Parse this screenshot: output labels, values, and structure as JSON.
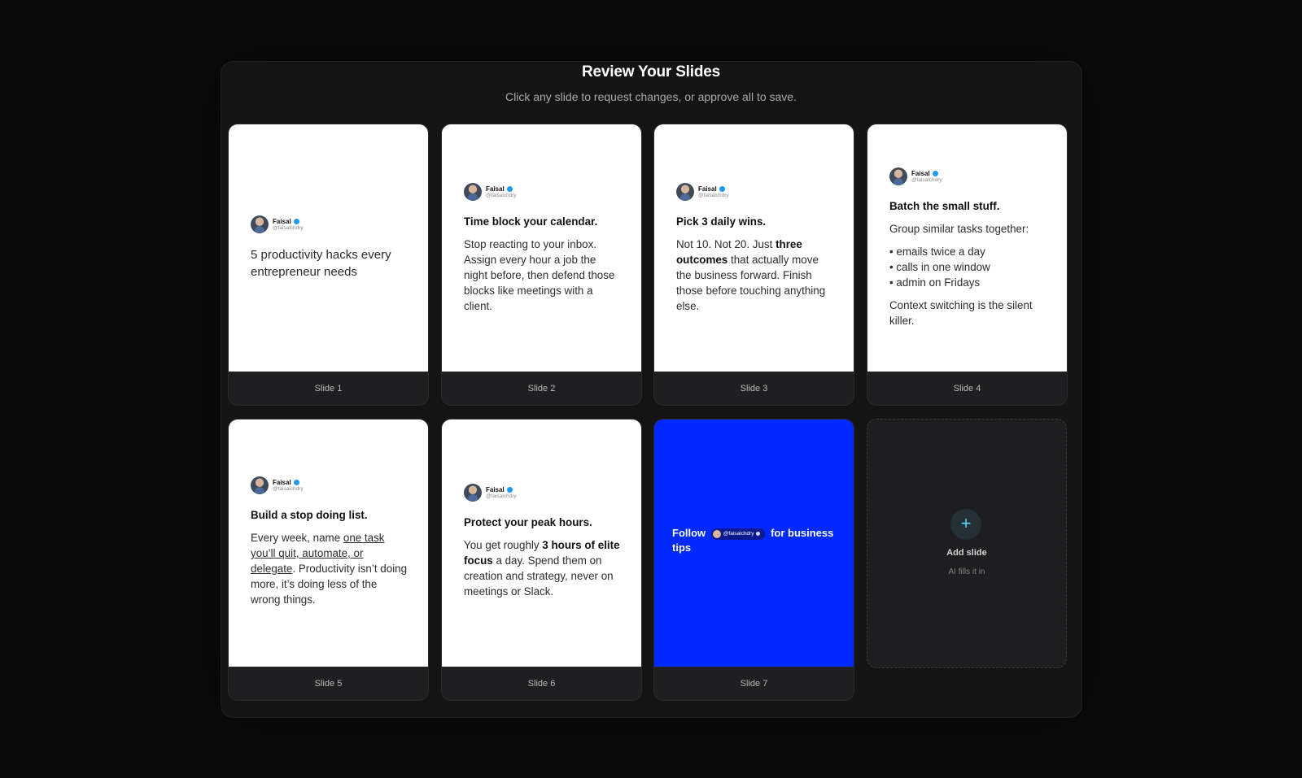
{
  "header": {
    "title": "Review Your Slides",
    "subtitle": "Click any slide to request changes, or approve all to save."
  },
  "author": {
    "name": "Faisal",
    "handle": "@faisalchdry"
  },
  "slides": [
    {
      "label": "Slide 1",
      "text": "5 productivity hacks every entrepreneur needs"
    },
    {
      "label": "Slide 2",
      "heading": "Time block your calendar.",
      "body": "Stop reacting to your inbox. Assign every hour a job the night before, then defend those blocks like meetings with a client."
    },
    {
      "label": "Slide 3",
      "heading": "Pick 3 daily wins.",
      "body_pre": "Not 10. Not 20. Just ",
      "body_bold": "three outcomes",
      "body_post": " that actually move the business forward. Finish those before touching anything else."
    },
    {
      "label": "Slide 4",
      "heading": "Batch the small stuff.",
      "intro": "Group similar tasks together:",
      "items": [
        "• emails twice a day",
        "• calls in one window",
        "• admin on Fridays"
      ],
      "outro": "Context switching is the silent killer."
    },
    {
      "label": "Slide 5",
      "heading": "Build a stop doing list.",
      "body_pre": "Every week, name ",
      "body_underline": "one task you’ll quit, automate, or delegate",
      "body_post": ". Productivity isn’t doing more, it’s doing less of the wrong things."
    },
    {
      "label": "Slide 6",
      "heading": "Protect your peak hours.",
      "body_pre": "You get roughly ",
      "body_bold": "3 hours of elite focus",
      "body_post": " a day. Spend them on creation and strategy, never on meetings or Slack."
    },
    {
      "label": "Slide 7",
      "follow_pre": "Follow",
      "follow_handle": "@faisalchdry",
      "follow_post": "for business tips",
      "bg_color": "#0029ff"
    }
  ],
  "add_slide": {
    "icon": "+",
    "label": "Add slide",
    "sublabel": "AI fills it in"
  }
}
